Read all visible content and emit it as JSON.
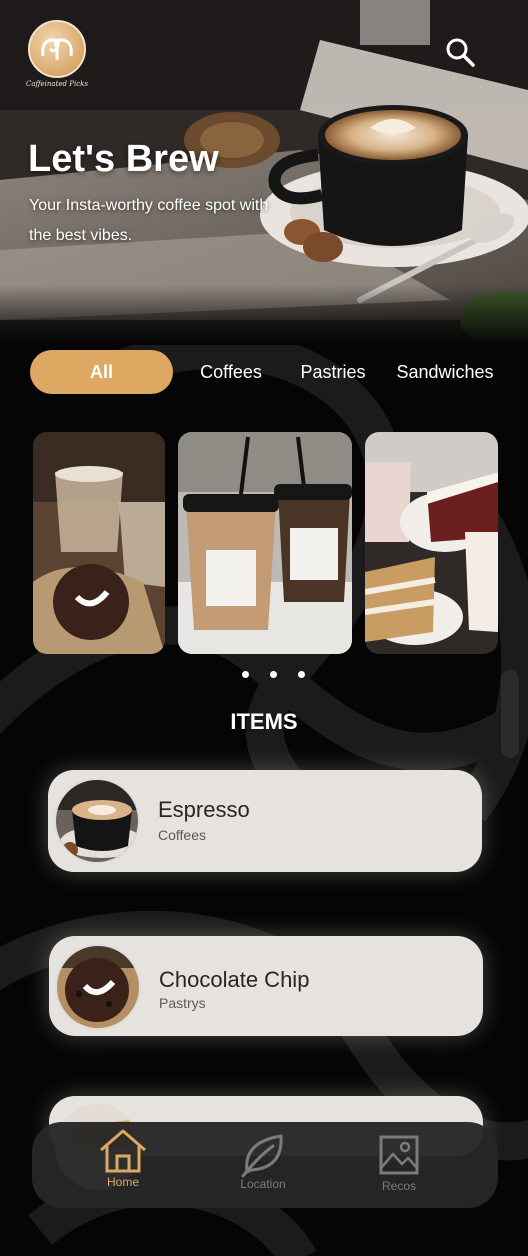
{
  "app": {
    "logo_text": "Caffeinated Picks"
  },
  "hero": {
    "title": "Let's Brew",
    "subtitle": "Your Insta-worthy coffee spot with the best vibes."
  },
  "categories": [
    {
      "label": "All",
      "active": true
    },
    {
      "label": "Coffees",
      "active": false
    },
    {
      "label": "Pastries",
      "active": false
    },
    {
      "label": "Sandwiches",
      "active": false
    }
  ],
  "carousel": {
    "slides": [
      "iced-coffee-and-cookie",
      "colombia-costa-rica-iced-coffees",
      "cakes-and-drinks"
    ],
    "active_dot": 1
  },
  "items_section": {
    "title": "ITEMS",
    "items": [
      {
        "name": "Espresso",
        "category": "Coffees"
      },
      {
        "name": "Chocolate Chip",
        "category": "Pastrys"
      }
    ]
  },
  "bottom_nav": {
    "items": [
      {
        "label": "Home",
        "icon": "home-icon",
        "active": true
      },
      {
        "label": "Location",
        "icon": "leaf-icon",
        "active": false
      },
      {
        "label": "Recos",
        "icon": "image-icon",
        "active": false
      }
    ]
  },
  "colors": {
    "accent": "#dca862",
    "background": "#050505",
    "card": "#e6e2de",
    "nav_bg": "#262626"
  }
}
